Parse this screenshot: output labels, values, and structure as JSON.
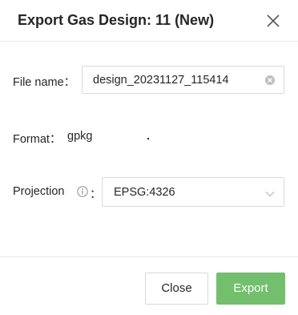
{
  "dialog": {
    "title": "Export Gas Design: 11 (New)",
    "close_icon": "close-icon"
  },
  "file_name": {
    "label": "File name：",
    "value": "design_20231127_115414",
    "clear_icon": "clear-circle-icon"
  },
  "format": {
    "label": "Format：",
    "value": "gpkg"
  },
  "projection": {
    "label": "Projection",
    "info_icon": "info-circle-icon",
    "separator": "：",
    "value": "EPSG:4326",
    "dropdown_icon": "chevron-down-icon"
  },
  "footer": {
    "close_label": "Close",
    "export_label": "Export"
  },
  "colors": {
    "primary": "#73bf6e",
    "border": "#d9d9d9",
    "text": "#262626"
  }
}
